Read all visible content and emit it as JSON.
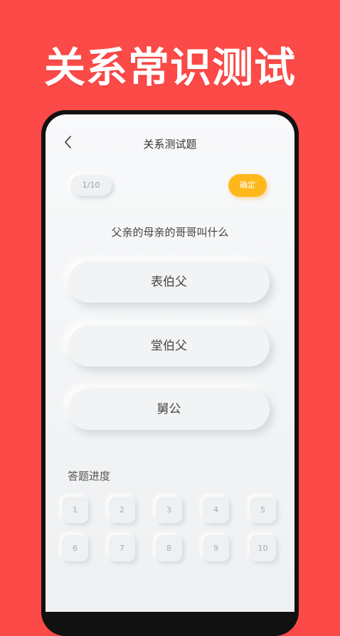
{
  "banner": {
    "title": "关系常识测试"
  },
  "nav": {
    "title": "关系测试题",
    "back_icon": "chevron-left-icon"
  },
  "quiz": {
    "counter": "1/10",
    "confirm_label": "确定",
    "question": "父亲的母亲的哥哥叫什么",
    "options": [
      "表伯父",
      "堂伯父",
      "舅公"
    ]
  },
  "progress": {
    "label": "答题进度",
    "numbers": [
      "1",
      "2",
      "3",
      "4",
      "5",
      "6",
      "7",
      "8",
      "9",
      "10"
    ]
  },
  "colors": {
    "background": "#fb4a47",
    "accent": "#ffb81c",
    "screen": "#f8f9fa"
  }
}
